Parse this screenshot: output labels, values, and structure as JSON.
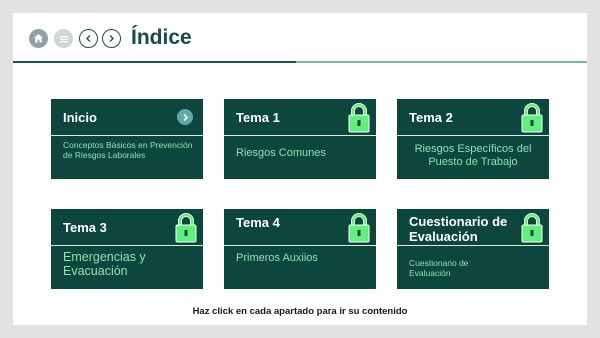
{
  "header": {
    "title": "Índice",
    "nav": [
      {
        "name": "home-button",
        "icon": "home-icon"
      },
      {
        "name": "menu-button",
        "icon": "menu-icon"
      },
      {
        "name": "previous-button",
        "icon": "chevron-left-icon"
      },
      {
        "name": "next-button",
        "icon": "chevron-right-icon"
      }
    ]
  },
  "cards": [
    {
      "title": "Inicio",
      "subtitle": "Conceptos Básicos en Prevención de Riesgos Laborales",
      "locked": false,
      "action_icon": "arrow-right-icon"
    },
    {
      "title": "Tema 1",
      "subtitle": "Riesgos Comunes",
      "locked": true
    },
    {
      "title": "Tema 2",
      "subtitle": "Riesgos Específicos del Puesto de Trabajo",
      "locked": true
    },
    {
      "title": "Tema 3",
      "subtitle": "Emergencias y Evacuación",
      "locked": true
    },
    {
      "title": "Tema 4",
      "subtitle": "Primeros Auxiios",
      "locked": true
    },
    {
      "title": "Cuestionario de Evaluación",
      "subtitle": "Cuestionario de Evaluación",
      "locked": true
    }
  ],
  "footer": {
    "instruction": "Haz click en cada apartado para ir su contenido"
  },
  "colors": {
    "card_bg": "#0d463c",
    "subtitle": "#8fe0b2",
    "lock": "#5ef07a",
    "title": "#1b4a41"
  }
}
